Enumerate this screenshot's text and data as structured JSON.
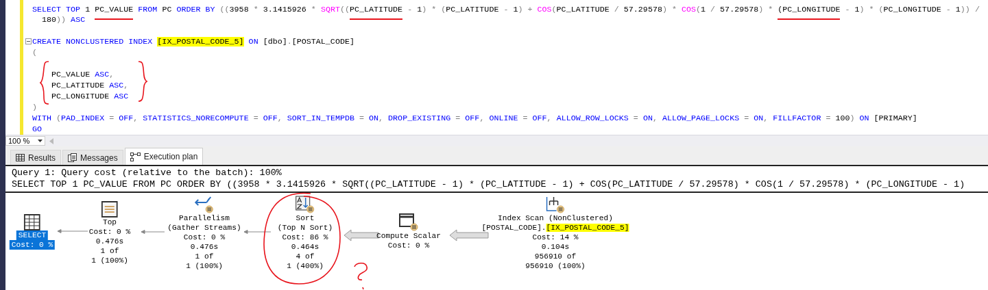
{
  "editor": {
    "lines": [
      {
        "kind": "code",
        "tokens": [
          {
            "kind": "keyword",
            "t": "SELECT TOP "
          },
          {
            "kind": "plain",
            "t": "1 "
          },
          {
            "kind": "plain",
            "t": "PC_VALUE",
            "marked": true
          },
          {
            "kind": "keyword",
            "t": " FROM "
          },
          {
            "kind": "plain",
            "t": "PC "
          },
          {
            "kind": "keyword",
            "t": "ORDER BY "
          },
          {
            "kind": "operator",
            "t": "(("
          },
          {
            "kind": "plain",
            "t": "3958 "
          },
          {
            "kind": "operator",
            "t": "* "
          },
          {
            "kind": "plain",
            "t": "3.1415926 "
          },
          {
            "kind": "operator",
            "t": "* "
          },
          {
            "kind": "function",
            "t": "SQRT"
          },
          {
            "kind": "operator",
            "t": "(("
          },
          {
            "kind": "plain",
            "t": "PC_LATITUDE",
            "marked": true
          },
          {
            "kind": "operator",
            "t": " - "
          },
          {
            "kind": "plain",
            "t": "1"
          },
          {
            "kind": "operator",
            "t": ") * ("
          },
          {
            "kind": "plain",
            "t": "PC_LATITUDE "
          },
          {
            "kind": "operator",
            "t": "- "
          },
          {
            "kind": "plain",
            "t": "1"
          },
          {
            "kind": "operator",
            "t": ") + "
          },
          {
            "kind": "function",
            "t": "COS"
          },
          {
            "kind": "operator",
            "t": "("
          },
          {
            "kind": "plain",
            "t": "PC_LATITUDE "
          },
          {
            "kind": "operator",
            "t": "/ "
          },
          {
            "kind": "plain",
            "t": "57.29578"
          },
          {
            "kind": "operator",
            "t": ") * "
          },
          {
            "kind": "function",
            "t": "COS"
          },
          {
            "kind": "operator",
            "t": "("
          },
          {
            "kind": "plain",
            "t": "1 "
          },
          {
            "kind": "operator",
            "t": "/ "
          },
          {
            "kind": "plain",
            "t": "57.29578"
          },
          {
            "kind": "operator",
            "t": ") * "
          },
          {
            "kind": "plain",
            "t": "(PC_LONGITUDE",
            "marked": true
          },
          {
            "kind": "operator",
            "t": " - "
          },
          {
            "kind": "plain",
            "t": "1"
          },
          {
            "kind": "operator",
            "t": ") * ("
          },
          {
            "kind": "plain",
            "t": "PC_LONGITUDE "
          },
          {
            "kind": "operator",
            "t": "- "
          },
          {
            "kind": "plain",
            "t": "1"
          },
          {
            "kind": "operator",
            "t": ")) /"
          }
        ]
      },
      {
        "kind": "code",
        "tokens": [
          {
            "kind": "plain",
            "t": "  180"
          },
          {
            "kind": "operator",
            "t": "))"
          },
          {
            "kind": "keyword",
            "t": " ASC"
          }
        ]
      },
      {
        "kind": "blank"
      },
      {
        "kind": "fold_start",
        "tokens": [
          {
            "kind": "keyword",
            "t": "CREATE NONCLUSTERED INDEX "
          },
          {
            "kind": "highlight",
            "t": "[IX_POSTAL_CODE_5]"
          },
          {
            "kind": "keyword",
            "t": " ON "
          },
          {
            "kind": "plain",
            "t": "[dbo]"
          },
          {
            "kind": "operator",
            "t": "."
          },
          {
            "kind": "plain",
            "t": "[POSTAL_CODE]"
          }
        ]
      },
      {
        "kind": "code",
        "tokens": [
          {
            "kind": "operator",
            "t": "("
          }
        ]
      },
      {
        "kind": "blank"
      },
      {
        "kind": "code",
        "tokens": [
          {
            "kind": "plain",
            "t": "    PC_VALUE "
          },
          {
            "kind": "keyword",
            "t": "ASC"
          },
          {
            "kind": "operator",
            "t": ","
          }
        ]
      },
      {
        "kind": "code",
        "tokens": [
          {
            "kind": "plain",
            "t": "    PC_LATITUDE "
          },
          {
            "kind": "keyword",
            "t": "ASC"
          },
          {
            "kind": "operator",
            "t": ","
          }
        ]
      },
      {
        "kind": "code",
        "tokens": [
          {
            "kind": "plain",
            "t": "    PC_LONGITUDE "
          },
          {
            "kind": "keyword",
            "t": "ASC"
          }
        ]
      },
      {
        "kind": "code",
        "tokens": [
          {
            "kind": "operator",
            "t": ")"
          }
        ]
      },
      {
        "kind": "code",
        "tokens": [
          {
            "kind": "keyword",
            "t": "WITH "
          },
          {
            "kind": "operator",
            "t": "("
          },
          {
            "kind": "keyword",
            "t": "PAD_INDEX "
          },
          {
            "kind": "operator",
            "t": "= "
          },
          {
            "kind": "keyword",
            "t": "OFF"
          },
          {
            "kind": "operator",
            "t": ", "
          },
          {
            "kind": "keyword",
            "t": "STATISTICS_NORECOMPUTE "
          },
          {
            "kind": "operator",
            "t": "= "
          },
          {
            "kind": "keyword",
            "t": "OFF"
          },
          {
            "kind": "operator",
            "t": ", "
          },
          {
            "kind": "keyword",
            "t": "SORT_IN_TEMPDB "
          },
          {
            "kind": "operator",
            "t": "= "
          },
          {
            "kind": "keyword",
            "t": "ON"
          },
          {
            "kind": "operator",
            "t": ", "
          },
          {
            "kind": "keyword",
            "t": "DROP_EXISTING "
          },
          {
            "kind": "operator",
            "t": "= "
          },
          {
            "kind": "keyword",
            "t": "OFF"
          },
          {
            "kind": "operator",
            "t": ", "
          },
          {
            "kind": "keyword",
            "t": "ONLINE "
          },
          {
            "kind": "operator",
            "t": "= "
          },
          {
            "kind": "keyword",
            "t": "OFF"
          },
          {
            "kind": "operator",
            "t": ", "
          },
          {
            "kind": "keyword",
            "t": "ALLOW_ROW_LOCKS "
          },
          {
            "kind": "operator",
            "t": "= "
          },
          {
            "kind": "keyword",
            "t": "ON"
          },
          {
            "kind": "operator",
            "t": ", "
          },
          {
            "kind": "keyword",
            "t": "ALLOW_PAGE_LOCKS "
          },
          {
            "kind": "operator",
            "t": "= "
          },
          {
            "kind": "keyword",
            "t": "ON"
          },
          {
            "kind": "operator",
            "t": ", "
          },
          {
            "kind": "keyword",
            "t": "FILLFACTOR "
          },
          {
            "kind": "operator",
            "t": "= "
          },
          {
            "kind": "plain",
            "t": "100"
          },
          {
            "kind": "operator",
            "t": ") "
          },
          {
            "kind": "keyword",
            "t": "ON "
          },
          {
            "kind": "plain",
            "t": "[PRIMARY]"
          }
        ]
      },
      {
        "kind": "code",
        "tokens": [
          {
            "kind": "keyword",
            "t": "GO"
          }
        ]
      }
    ]
  },
  "zoom": {
    "value": "100 %"
  },
  "tabs": [
    {
      "kind": "grid",
      "label": "Results",
      "selected": false
    },
    {
      "kind": "messages",
      "label": "Messages",
      "selected": false
    },
    {
      "kind": "plan",
      "label": "Execution plan",
      "selected": true
    }
  ],
  "plan": {
    "header": [
      "Query 1: Query cost (relative to the batch): 100%",
      "SELECT TOP 1 PC_VALUE FROM PC ORDER BY ((3958 * 3.1415926 * SQRT((PC_LATITUDE - 1) * (PC_LATITUDE - 1) + COS(PC_LATITUDE / 57.29578) * COS(1 / 57.29578) * (PC_LONGITUDE - 1)"
    ],
    "nodes": [
      {
        "kind": "select",
        "selected": true,
        "lines": [
          {
            "text": "SELECT"
          },
          {
            "text": "Cost: 0 %"
          }
        ]
      },
      {
        "kind": "top",
        "selected": false,
        "lines": [
          {
            "text": "Top"
          },
          {
            "text": "Cost: 0 %"
          },
          {
            "text": "0.476s"
          },
          {
            "text": "1 of"
          },
          {
            "text": "1 (100%)"
          }
        ]
      },
      {
        "kind": "parallelism",
        "selected": false,
        "lines": [
          {
            "text": "Parallelism"
          },
          {
            "text": "(Gather Streams)"
          },
          {
            "text": "Cost: 0 %"
          },
          {
            "text": "0.476s"
          },
          {
            "text": "1 of"
          },
          {
            "text": "1 (100%)"
          }
        ]
      },
      {
        "kind": "sort",
        "selected": false,
        "lines": [
          {
            "text": "Sort"
          },
          {
            "text": "(Top N Sort)"
          },
          {
            "text": "Cost: 86 %"
          },
          {
            "text": "0.464s"
          },
          {
            "text": "4 of"
          },
          {
            "text": "1 (400%)"
          }
        ]
      },
      {
        "kind": "compute_scalar",
        "selected": false,
        "lines": [
          {
            "text": "Compute Scalar"
          },
          {
            "text": "Cost: 0 %"
          }
        ]
      },
      {
        "kind": "index_scan",
        "selected": false,
        "lines": [
          {
            "text": "Index Scan (NonClustered)"
          },
          {
            "text": "[POSTAL_CODE].",
            "highlighted_text": "[IX_POSTAL_CODE_5]"
          },
          {
            "text": "Cost: 14 %"
          },
          {
            "text": "0.104s"
          },
          {
            "text": "956910 of"
          },
          {
            "text": "956910 (100%)"
          }
        ]
      }
    ]
  }
}
